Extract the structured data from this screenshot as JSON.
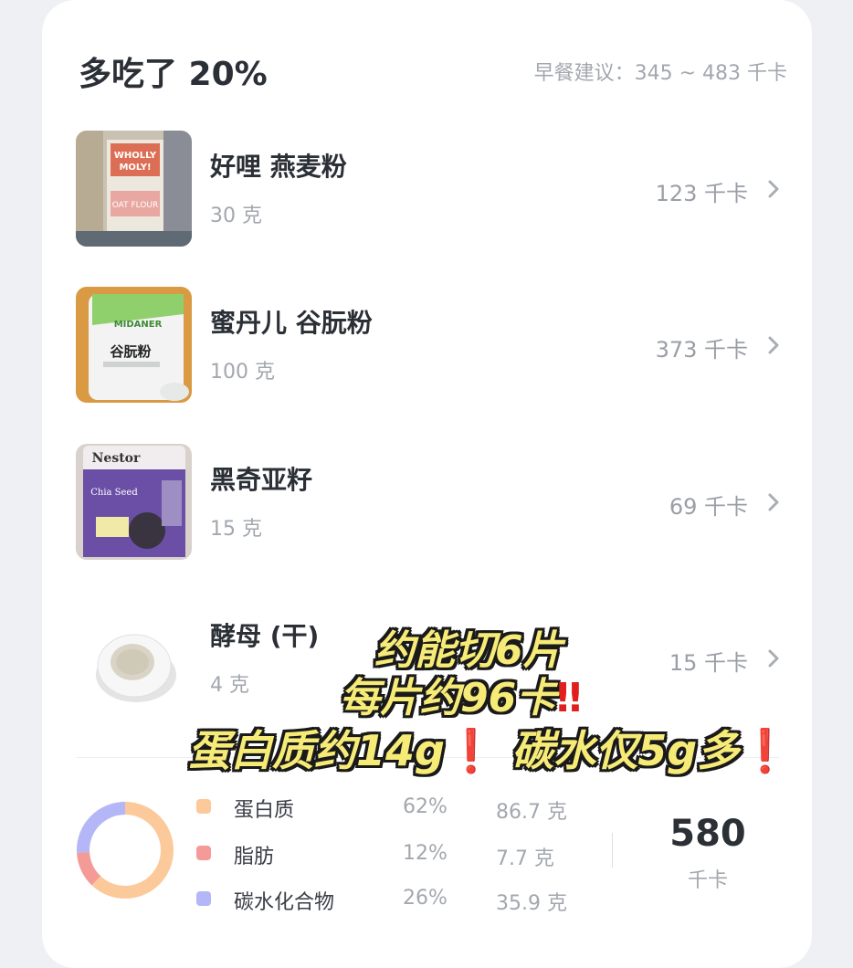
{
  "header": {
    "title": "多吃了 20%",
    "suggestion": "早餐建议：345 ~ 483 千卡"
  },
  "foods": [
    {
      "name": "好哩 燕麦粉",
      "amount": "30 克",
      "calories": "123 千卡",
      "package_text": [
        "WHOLLY",
        "MOLY!",
        "OAT FLOUR"
      ]
    },
    {
      "name": "蜜丹儿 谷朊粉",
      "amount": "100 克",
      "calories": "373 千卡",
      "package_text": [
        "MIDANER",
        "谷朊粉"
      ]
    },
    {
      "name": "黑奇亚籽",
      "amount": "15 克",
      "calories": "69 千卡",
      "package_text": [
        "Nestor",
        "Chia Seed"
      ]
    },
    {
      "name": "酵母 (干)",
      "amount": "4 克",
      "calories": "15 千卡"
    }
  ],
  "overlay": {
    "line1": "约能切6片",
    "line2": "每片约96卡",
    "line2_mark": "‼",
    "line3a": "蛋白质约14g",
    "line3_mark1": "❗",
    "line3b": "碳水仅5g多",
    "line3_mark2": "❗"
  },
  "nutrition": [
    {
      "name": "蛋白质",
      "percent": "62%",
      "grams": "86.7 克",
      "color": "#fcc99a"
    },
    {
      "name": "脂肪",
      "percent": "12%",
      "grams": "7.7 克",
      "color": "#f49b97"
    },
    {
      "name": "碳水化合物",
      "percent": "26%",
      "grams": "35.9 克",
      "color": "#b4b6f7"
    }
  ],
  "total": {
    "value": "580",
    "unit": "千卡"
  },
  "colors": {
    "chevron": "#a9adb4"
  }
}
